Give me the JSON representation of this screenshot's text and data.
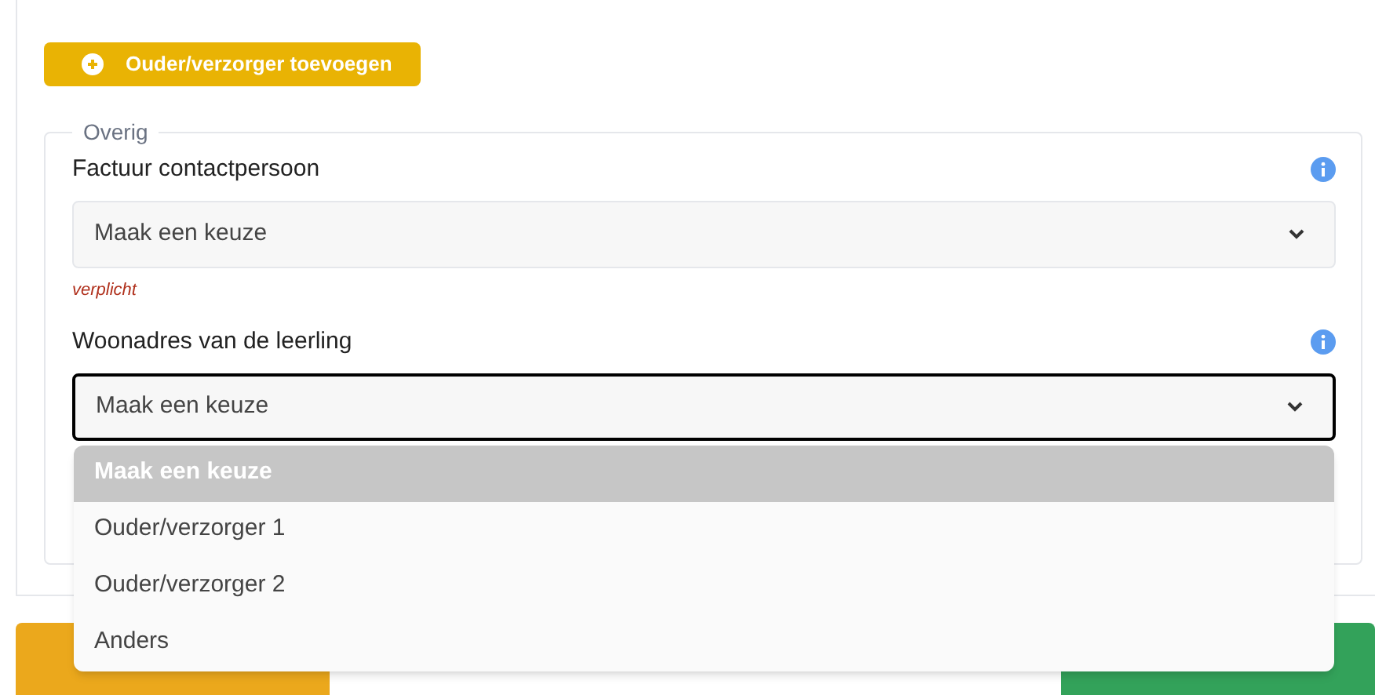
{
  "add_button": {
    "label": "Ouder/verzorger toevoegen"
  },
  "fieldset": {
    "legend": "Overig",
    "fields": [
      {
        "label": "Factuur contactpersoon",
        "value": "Maak een keuze",
        "focused": false,
        "error": "verplicht"
      },
      {
        "label": "Woonadres van de leerling",
        "value": "Maak een keuze",
        "focused": true,
        "expanded": true,
        "options": [
          {
            "label": "Maak een keuze",
            "selected": true
          },
          {
            "label": "Ouder/verzorger 1",
            "selected": false
          },
          {
            "label": "Ouder/verzorger 2",
            "selected": false
          },
          {
            "label": "Anders",
            "selected": false
          }
        ]
      }
    ]
  }
}
